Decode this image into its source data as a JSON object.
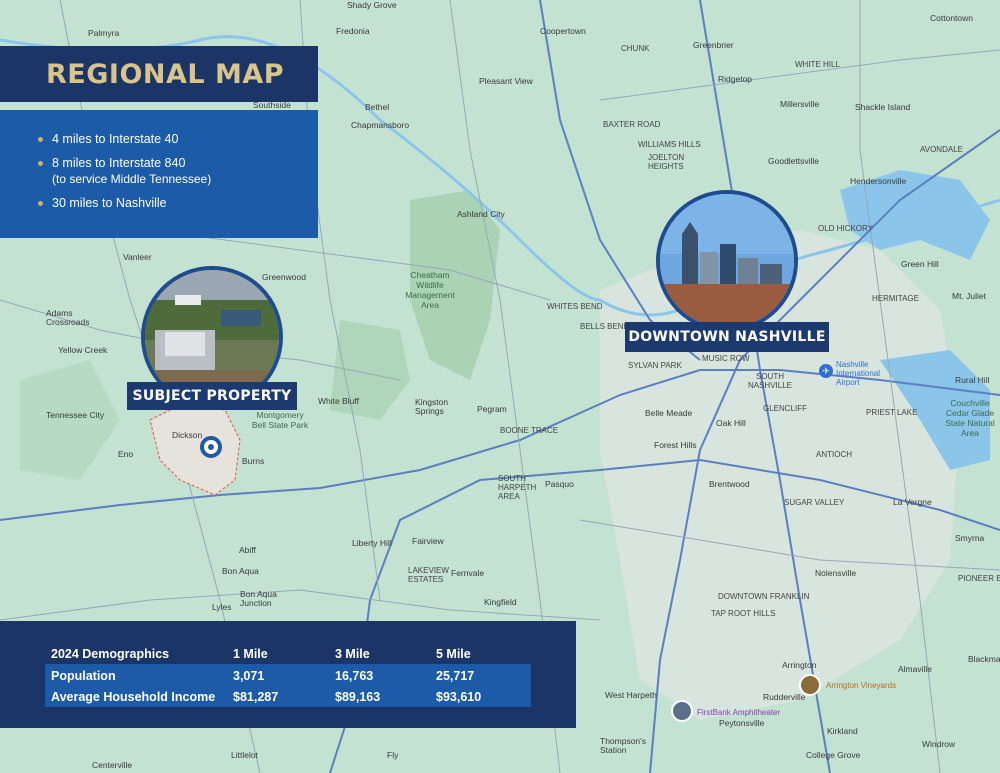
{
  "header": {
    "title": "REGIONAL MAP"
  },
  "highlights": [
    {
      "text": "4 miles to Interstate 40"
    },
    {
      "text": "8 miles to Interstate 840",
      "sub": "(to service Middle Tennessee)"
    },
    {
      "text": "30 miles to Nashville"
    }
  ],
  "markers": {
    "subject": "SUBJECT PROPERTY",
    "downtown": "DOWNTOWN NASHVILLE"
  },
  "demographics": {
    "header": "2024 Demographics",
    "columns": [
      "1 Mile",
      "3 Mile",
      "5 Mile"
    ],
    "rows": [
      {
        "label": "Population",
        "values": [
          "3,071",
          "16,763",
          "25,717"
        ]
      },
      {
        "label": "Average Household Income",
        "values": [
          "$81,287",
          "$89,163",
          "$93,610"
        ]
      }
    ]
  },
  "map_labels": {
    "shady_grove": "Shady Grove",
    "palmyra": "Palmyra",
    "fredonia": "Fredonia",
    "coopertown": "Coopertown",
    "chunk": "CHUNK",
    "greenbrier": "Greenbrier",
    "cottontown": "Cottontown",
    "white_hill": "WHITE HILL",
    "pleasant_view": "Pleasant View",
    "ridgetop": "Ridgetop",
    "millersville": "Millersville",
    "shackle_island": "Shackle Island",
    "southside": "Southside",
    "bethel": "Bethel",
    "chapmansboro": "Chapmansboro",
    "baxter_road": "BAXTER ROAD",
    "williams_hills": "WILLIAMS HILLS",
    "joelton_heights": "JOELTON HEIGHTS",
    "goodlettsville": "Goodlettsville",
    "avondale": "AVONDALE",
    "hendersonville": "Hendersonville",
    "ashland_city": "Ashland City",
    "old_hickory": "OLD HICKORY",
    "vanleer": "Vanleer",
    "greenwood": "Greenwood",
    "cheatham": "Cheatham Wildlife Management Area",
    "green_hill": "Green Hill",
    "hermitage": "HERMITAGE",
    "mt_juliet": "Mt. Juliet",
    "adams_crossroads": "Adams Crossroads",
    "whites_bend": "WHITES BEND",
    "bells_bend": "BELLS BEND",
    "yellow_creek": "Yellow Creek",
    "music_row": "MUSIC ROW",
    "sylvan_park": "SYLVAN PARK",
    "south_nashville": "SOUTH NASHVILLE",
    "nashville_airport": "Nashville International Airport",
    "rural_hill": "Rural Hill",
    "tennessee_city": "Tennessee City",
    "white_bluff": "White Bluff",
    "kingston_springs": "Kingston Springs",
    "pegram": "Pegram",
    "montgomery": "Montgomery Bell State Park",
    "belle_meade": "Belle Meade",
    "glencliff": "GLENCLIFF",
    "priest_lake": "PRIEST LAKE",
    "couchville": "Couchville Cedar Glade State Natural Area",
    "dickson": "Dickson",
    "boone_trace": "BOONE TRACE",
    "oak_hill": "Oak Hill",
    "eno": "Eno",
    "burns": "Burns",
    "forest_hills": "Forest Hills",
    "antioch": "ANTIOCH",
    "south_harpeth": "SOUTH HARPETH AREA",
    "pasquo": "Pasquo",
    "brentwood": "Brentwood",
    "sugar_valley": "SUGAR VALLEY",
    "la_vergne": "La Vergne",
    "liberty_hill": "Liberty Hill",
    "fairview": "Fairview",
    "abiff": "Abiff",
    "smyrna": "Smyrna",
    "bon_aqua": "Bon Aqua",
    "lakeview_estates": "LAKEVIEW ESTATES",
    "fernvale": "Fernvale",
    "nolensville": "Nolensville",
    "bon_aqua_junction": "Bon Aqua Junction",
    "lyles": "Lyles",
    "pioneer_estates": "PIONEER ESTATES",
    "kingfield": "Kingfield",
    "downtown_franklin": "DOWNTOWN FRANKLIN",
    "tap_root_hills": "TAP ROOT HILLS",
    "arrington": "Arrington",
    "almaville": "Almaville",
    "blackman": "Blackman",
    "arrington_vineyards": "Arrington Vineyards",
    "west_harpeth": "West Harpeth",
    "rudderville": "Rudderville",
    "firstbank": "FirstBank Amphitheater",
    "peytonsville": "Peytonsville",
    "kirkland": "Kirkland",
    "thompsons_station": "Thompson's Station",
    "windrow": "Windrow",
    "centerville": "Centerville",
    "littlelot": "Littlelot",
    "fly": "Fly",
    "college_grove": "College Grove"
  }
}
